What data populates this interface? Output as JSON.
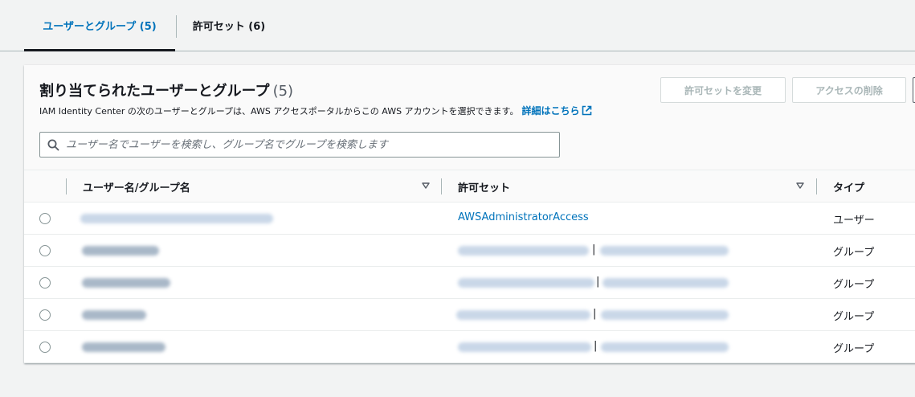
{
  "tabs": [
    {
      "label": "ユーザーとグループ (5)",
      "active": true
    },
    {
      "label": "許可セット (6)",
      "active": false
    }
  ],
  "panel": {
    "title": "割り当てられたユーザーとグループ",
    "count": "(5)",
    "description": "IAM Identity Center の次のユーザーとグループは、AWS アクセスポータルからこの AWS アカウントを選択できます。",
    "learn_more": "詳細はこちら",
    "buttons": {
      "change_permission_set": "許可セットを変更",
      "remove_access": "アクセスの削除"
    },
    "search": {
      "placeholder": "ユーザー名でユーザーを検索し、グループ名でグループを検索します",
      "value": ""
    }
  },
  "table": {
    "columns": [
      "ユーザー名/グループ名",
      "許可セット",
      "タイプ"
    ],
    "rows": [
      {
        "name": "[blurred]",
        "permission_set": "AWSAdministratorAccess",
        "type": "ユーザー"
      },
      {
        "name": "[blurred]",
        "permission_set": "[blurred]",
        "type": "グループ"
      },
      {
        "name": "[blurred]",
        "permission_set": "[blurred]",
        "type": "グループ"
      },
      {
        "name": "[blurred]",
        "permission_set": "[blurred]",
        "type": "グループ"
      },
      {
        "name": "[blurred]",
        "permission_set": "[blurred]",
        "type": "グループ"
      }
    ]
  },
  "colors": {
    "accent": "#0073bb",
    "text": "#16191f",
    "disabled": "#aab7b8",
    "background": "#f2f3f3"
  },
  "icons": [
    "search-icon",
    "external-link-icon",
    "sort-caret-icon"
  ]
}
